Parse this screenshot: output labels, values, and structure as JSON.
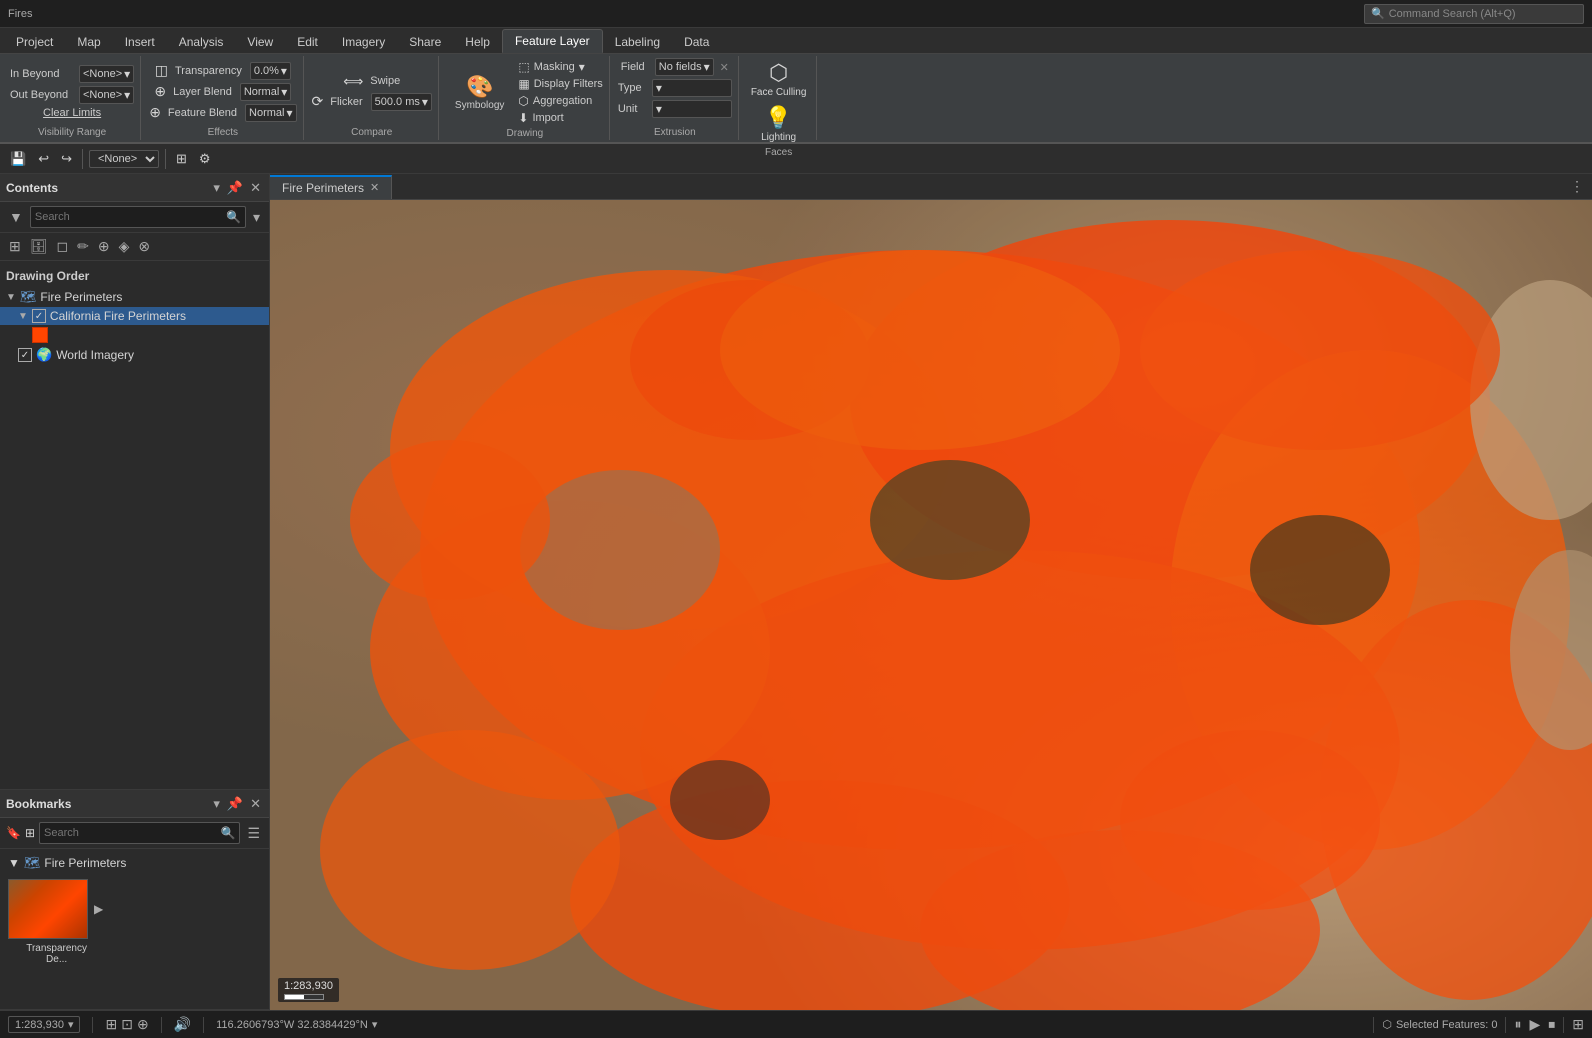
{
  "app": {
    "title": "Fires",
    "command_search_placeholder": "Command Search (Alt+Q)"
  },
  "ribbon_tabs": [
    {
      "label": "Project",
      "active": false
    },
    {
      "label": "Map",
      "active": false
    },
    {
      "label": "Insert",
      "active": false
    },
    {
      "label": "Analysis",
      "active": false
    },
    {
      "label": "View",
      "active": false
    },
    {
      "label": "Edit",
      "active": false
    },
    {
      "label": "Imagery",
      "active": false
    },
    {
      "label": "Share",
      "active": false
    },
    {
      "label": "Help",
      "active": false
    },
    {
      "label": "Feature Layer",
      "active": true
    },
    {
      "label": "Labeling",
      "active": false
    },
    {
      "label": "Data",
      "active": false
    }
  ],
  "ribbon": {
    "visibility_group": {
      "label": "Visibility Range",
      "in_beyond_label": "In Beyond",
      "out_beyond_label": "Out Beyond",
      "clear_limits_label": "Clear Limits",
      "in_beyond_value": "<None>",
      "out_beyond_value": "<None>"
    },
    "effects_group": {
      "label": "Effects",
      "transparency_label": "Transparency",
      "transparency_value": "0.0%",
      "layer_blend_label": "Layer Blend",
      "layer_blend_value": "Normal",
      "feature_blend_label": "Feature Blend",
      "feature_blend_value": "Normal"
    },
    "compare_group": {
      "label": "Compare",
      "swipe_label": "Swipe",
      "flicker_label": "Flicker",
      "flicker_value": "500.0 ms"
    },
    "drawing_group": {
      "label": "Drawing",
      "symbology_label": "Symbology",
      "masking_label": "Masking",
      "display_filters_label": "Display Filters",
      "aggregation_label": "Aggregation",
      "import_label": "Import"
    },
    "extrusion_group": {
      "label": "Extrusion",
      "field_label": "Field",
      "field_value": "No fields",
      "type_label": "Type",
      "unit_label": "Unit"
    },
    "faces_group": {
      "label": "Faces",
      "face_culling_label": "Face Culling",
      "lighting_label": "Lighting"
    }
  },
  "toolbar": {
    "none_value": "<None>"
  },
  "contents_panel": {
    "title": "Contents",
    "search_placeholder": "Search",
    "drawing_order_label": "Drawing Order",
    "layers": [
      {
        "id": "fire-perimeters-group",
        "label": "Fire Perimeters",
        "type": "group",
        "level": 0,
        "expanded": true
      },
      {
        "id": "california-fire-perimeters",
        "label": "California Fire Perimeters",
        "type": "layer",
        "level": 1,
        "selected": true,
        "checked": true
      },
      {
        "id": "world-imagery",
        "label": "World Imagery",
        "type": "layer",
        "level": 1,
        "selected": false,
        "checked": true
      }
    ]
  },
  "bookmarks_panel": {
    "title": "Bookmarks",
    "search_placeholder": "Search",
    "groups": [
      {
        "label": "Fire Perimeters",
        "items": [
          {
            "label": "Transparency De...",
            "thumb_bg": "#b84a10"
          }
        ]
      }
    ]
  },
  "map": {
    "tab_label": "Fire Perimeters",
    "scale": "1:283,930",
    "coordinates": "116.2606793°W 32.8384429°N",
    "selected_features": "Selected Features: 0"
  },
  "status_bar": {
    "scale_label": "1:283,930",
    "coords_label": "116.2606793°W 32.8384429°N",
    "selected_features_label": "Selected Features: 0"
  },
  "icons": {
    "search": "🔍",
    "expand": "▼",
    "collapse": "▲",
    "close": "✕",
    "pin": "📌",
    "arrow_right": "▶",
    "arrow_down": "▼",
    "check": "✓",
    "layers": "⊞",
    "gear": "⚙",
    "list": "☰",
    "filter": "▼"
  }
}
